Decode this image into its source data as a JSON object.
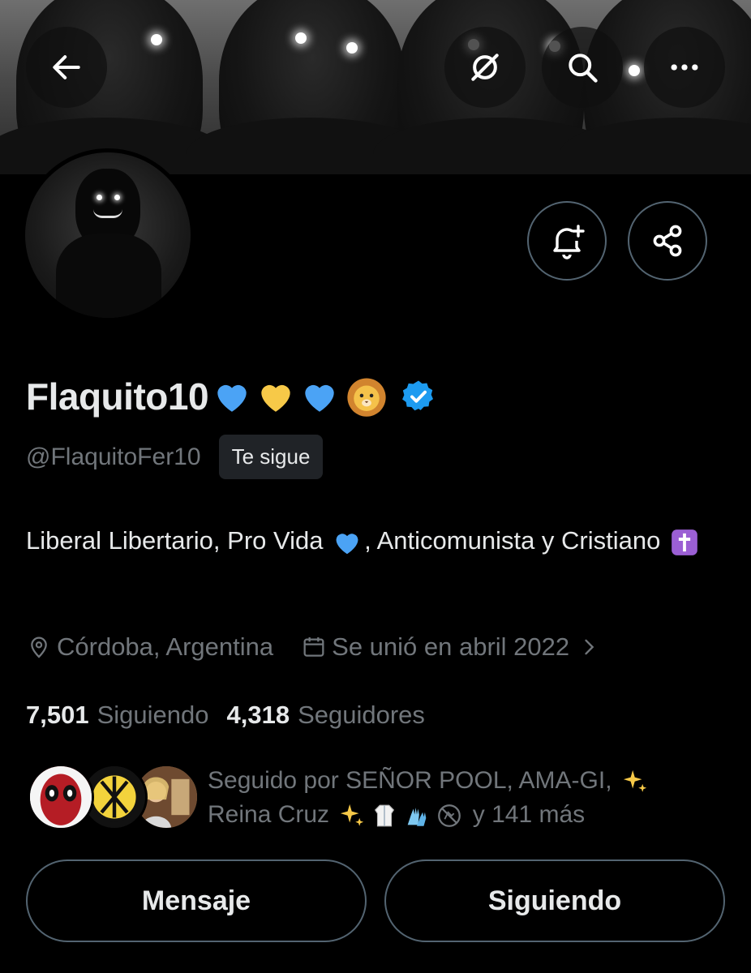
{
  "nav": {
    "back_icon": "arrow-left-icon",
    "grok_icon": "grok-icon",
    "search_icon": "search-icon",
    "more_icon": "more-dots-icon"
  },
  "actions": {
    "notify_icon": "bell-plus-icon",
    "share_icon": "share-icon"
  },
  "profile": {
    "display_name": "Flaquito10",
    "name_emojis": [
      "blue-heart",
      "yellow-heart",
      "blue-heart",
      "lion-face"
    ],
    "verified_color": "#1d9bf0",
    "handle": "@FlaquitoFer10",
    "follows_you": "Te sigue",
    "bio_part1": "Liberal Libertario, Pro Vida ",
    "bio_part2": ", Anticomunista y Cristiano ",
    "location": "Córdoba, Argentina",
    "joined": "Se unió en abril 2022"
  },
  "stats": {
    "following_count": "7,501",
    "following_label": "Siguiendo",
    "followers_count": "4,318",
    "followers_label": "Seguidores"
  },
  "followed_by": {
    "line1": "Seguido por SEÑOR POOL, AMA-GI, ",
    "line2a": "Reina Cruz ",
    "line2b": " y 141 más"
  },
  "buttons": {
    "message": "Mensaje",
    "following": "Siguiendo"
  },
  "colors": {
    "background": "#000000",
    "text_primary": "#e7e9ea",
    "text_secondary": "#71767b",
    "border": "#536471",
    "accent": "#1d9bf0"
  }
}
